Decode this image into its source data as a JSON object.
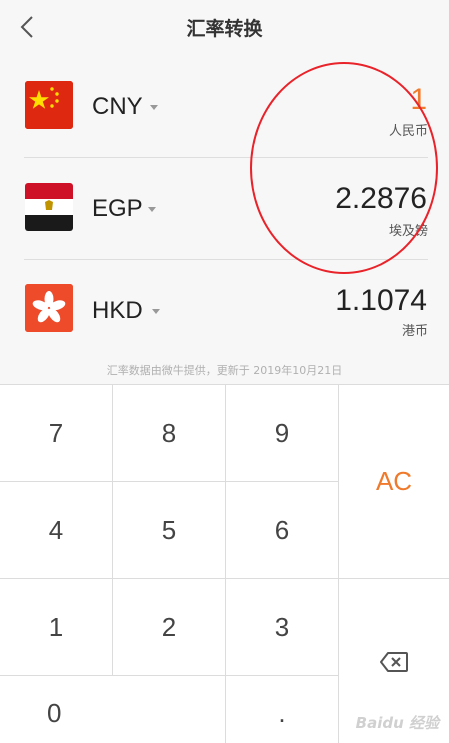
{
  "header": {
    "title": "汇率转换",
    "back_icon": "chevron-left-icon"
  },
  "currencies": [
    {
      "code": "CNY",
      "amount": "1",
      "name": "人民币",
      "flag": "china-flag-icon",
      "active": true
    },
    {
      "code": "EGP",
      "amount": "2.2876",
      "name": "埃及镑",
      "flag": "egypt-flag-icon",
      "active": false
    },
    {
      "code": "HKD",
      "amount": "1.1074",
      "name": "港币",
      "flag": "hongkong-flag-icon",
      "active": false
    }
  ],
  "footnote": "汇率数据由微牛提供，更新于 2019年10月21日",
  "keypad": {
    "k7": "7",
    "k8": "8",
    "k9": "9",
    "k4": "4",
    "k5": "5",
    "k6": "6",
    "k1": "1",
    "k2": "2",
    "k3": "3",
    "k0": "0",
    "kdot": ".",
    "clear": "AC",
    "backspace_icon": "backspace-icon"
  },
  "colors": {
    "accent": "#f07a2c",
    "annotation": "#e8232a",
    "background": "#f7f7f7"
  },
  "watermark": "Baidu 经验"
}
